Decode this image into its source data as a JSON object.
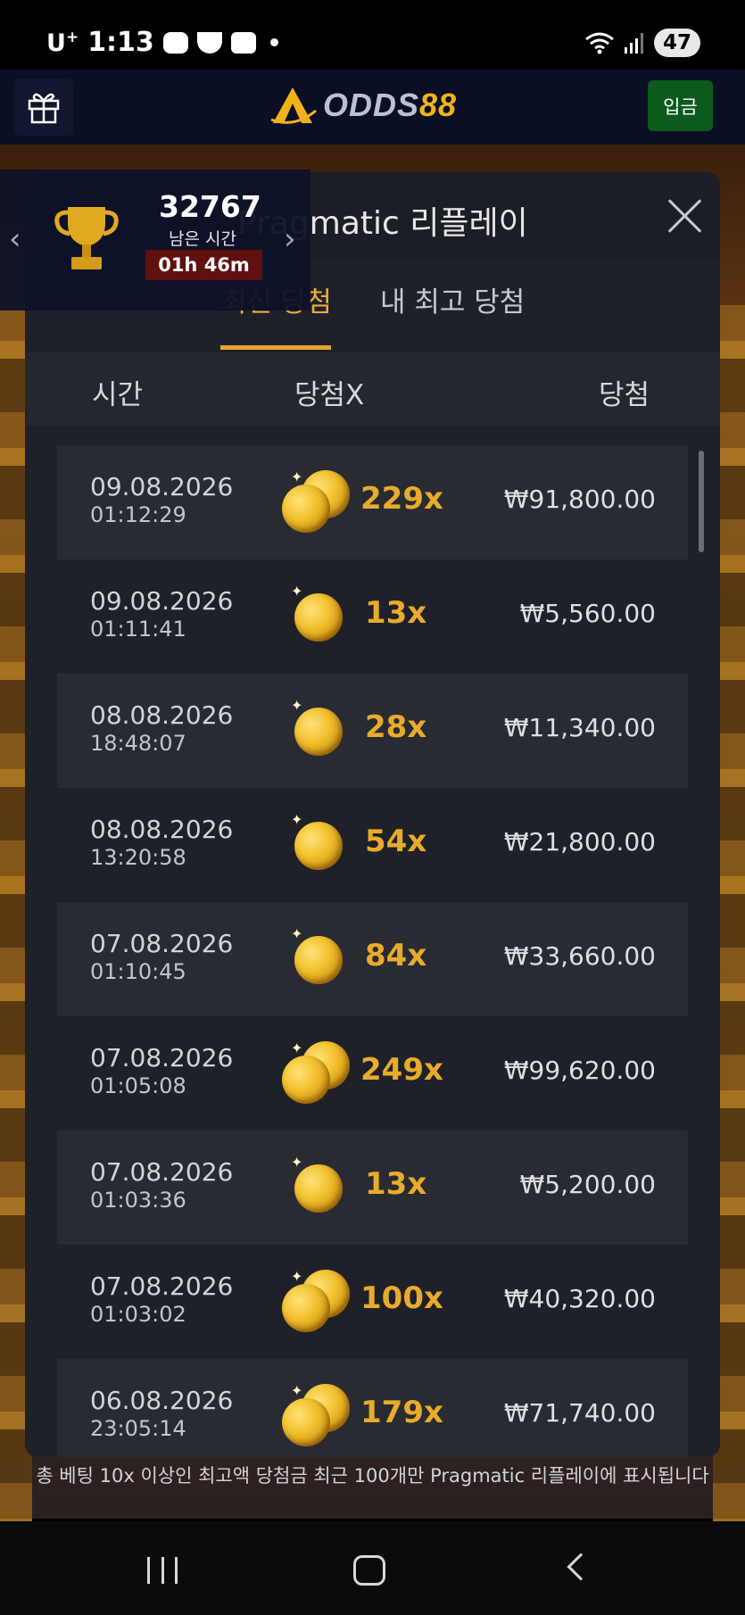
{
  "status_bar": {
    "carrier": "U",
    "carrier_sup": "+",
    "time": "1:13",
    "battery": "47"
  },
  "header": {
    "logo_text": "ODDS",
    "logo_accent": "88",
    "deposit_label": "입금"
  },
  "tournament": {
    "score": "32767",
    "remaining_label": "남은 시간",
    "timer": "01h 46m"
  },
  "modal": {
    "title": "Pragmatic 리플레이",
    "tabs": [
      "최신 당첨",
      "내 최고 당첨"
    ],
    "active_tab": 0,
    "columns": {
      "time": "시간",
      "multiplier": "당첨X",
      "win": "당첨"
    },
    "rows": [
      {
        "date": "09.08.2026",
        "time": "01:12:29",
        "mult": "229x",
        "amount": "₩91,800.00",
        "coins": 2
      },
      {
        "date": "09.08.2026",
        "time": "01:11:41",
        "mult": "13x",
        "amount": "₩5,560.00",
        "coins": 1
      },
      {
        "date": "08.08.2026",
        "time": "18:48:07",
        "mult": "28x",
        "amount": "₩11,340.00",
        "coins": 1
      },
      {
        "date": "08.08.2026",
        "time": "13:20:58",
        "mult": "54x",
        "amount": "₩21,800.00",
        "coins": 1
      },
      {
        "date": "07.08.2026",
        "time": "01:10:45",
        "mult": "84x",
        "amount": "₩33,660.00",
        "coins": 1
      },
      {
        "date": "07.08.2026",
        "time": "01:05:08",
        "mult": "249x",
        "amount": "₩99,620.00",
        "coins": 2
      },
      {
        "date": "07.08.2026",
        "time": "01:03:36",
        "mult": "13x",
        "amount": "₩5,200.00",
        "coins": 1
      },
      {
        "date": "07.08.2026",
        "time": "01:03:02",
        "mult": "100x",
        "amount": "₩40,320.00",
        "coins": 2
      },
      {
        "date": "06.08.2026",
        "time": "23:05:14",
        "mult": "179x",
        "amount": "₩71,740.00",
        "coins": 2
      }
    ],
    "footnote": "총 베팅 10x 이상인 최고액 당첨금 최근 100개만 Pragmatic 리플레이에 표시됩니다"
  },
  "colors": {
    "accent_gold": "#e6ac3a",
    "deposit_green": "#0c5a1c",
    "timer_red": "#611010",
    "modal_bg": "#1f2128"
  }
}
